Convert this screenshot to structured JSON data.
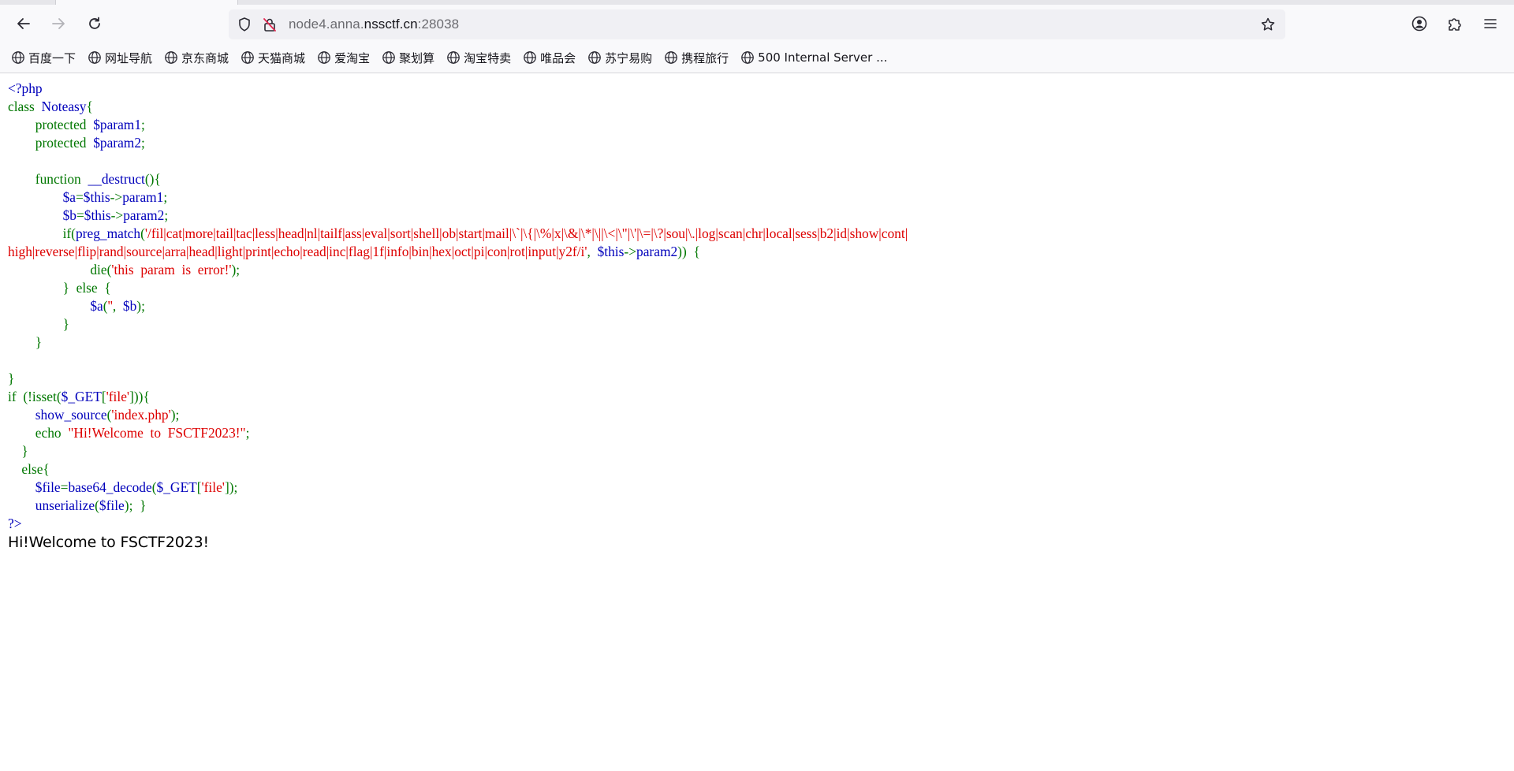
{
  "browser": {
    "url_prefix": "node4.anna.",
    "url_domain": "nssctf.cn",
    "url_port": ":28038",
    "bookmarks": [
      {
        "label": "百度一下",
        "icon": "globe-icon"
      },
      {
        "label": "网址导航",
        "icon": "globe-icon"
      },
      {
        "label": "京东商城",
        "icon": "globe-icon"
      },
      {
        "label": "天猫商城",
        "icon": "globe-icon"
      },
      {
        "label": "爱淘宝",
        "icon": "globe-icon"
      },
      {
        "label": "聚划算",
        "icon": "globe-icon"
      },
      {
        "label": "淘宝特卖",
        "icon": "globe-icon"
      },
      {
        "label": "唯品会",
        "icon": "globe-icon"
      },
      {
        "label": "苏宁易购",
        "icon": "globe-icon"
      },
      {
        "label": "携程旅行",
        "icon": "globe-icon"
      },
      {
        "label": "500 Internal Server ...",
        "icon": "globe-icon"
      }
    ]
  },
  "source_code": [
    [
      [
        "def",
        "<?php"
      ]
    ],
    [
      [
        "kw",
        "class"
      ],
      [
        "def",
        "  Noteasy"
      ],
      [
        "kw",
        "{"
      ]
    ],
    [
      [
        "kw",
        "        protected  "
      ],
      [
        "def",
        "$param1"
      ],
      [
        "kw",
        ";"
      ]
    ],
    [
      [
        "kw",
        "        protected  "
      ],
      [
        "def",
        "$param2"
      ],
      [
        "kw",
        ";"
      ]
    ],
    [
      [
        "def",
        ""
      ]
    ],
    [
      [
        "kw",
        "        function  "
      ],
      [
        "def",
        "__destruct"
      ],
      [
        "kw",
        "(){"
      ]
    ],
    [
      [
        "def",
        "                $a"
      ],
      [
        "kw",
        "="
      ],
      [
        "def",
        "$this"
      ],
      [
        "kw",
        "->"
      ],
      [
        "def",
        "param1"
      ],
      [
        "kw",
        ";"
      ]
    ],
    [
      [
        "def",
        "                $b"
      ],
      [
        "kw",
        "="
      ],
      [
        "def",
        "$this"
      ],
      [
        "kw",
        "->"
      ],
      [
        "def",
        "param2"
      ],
      [
        "kw",
        ";"
      ]
    ],
    [
      [
        "kw",
        "                if("
      ],
      [
        "def",
        "preg_match"
      ],
      [
        "kw",
        "("
      ],
      [
        "str",
        "'/fil|cat|more|tail|tac|less|head|nl|tailf|ass|eval|sort|shell|ob|start|mail|\\`|\\{|\\%|x|\\&|\\*|\\||\\<|\\\"|\\'|\\=|\\?|sou|\\.|log|scan|chr|local|sess|b2|id|show|cont|"
      ]
    ],
    [
      [
        "str",
        "high|reverse|flip|rand|source|arra|head|light|print|echo|read|inc|flag|1f|info|bin|hex|oct|pi|con|rot|input|y2f/i'"
      ],
      [
        "kw",
        ",  "
      ],
      [
        "def",
        "$this"
      ],
      [
        "kw",
        "->"
      ],
      [
        "def",
        "param2"
      ],
      [
        "kw",
        "))  {"
      ]
    ],
    [
      [
        "kw",
        "                        die("
      ],
      [
        "str",
        "'this  param  is  error!'"
      ],
      [
        "kw",
        ");"
      ]
    ],
    [
      [
        "kw",
        "                }  else  {"
      ]
    ],
    [
      [
        "def",
        "                        $a"
      ],
      [
        "kw",
        "("
      ],
      [
        "str",
        "''"
      ],
      [
        "kw",
        ",  "
      ],
      [
        "def",
        "$b"
      ],
      [
        "kw",
        ");"
      ]
    ],
    [
      [
        "kw",
        "                }"
      ]
    ],
    [
      [
        "kw",
        "        }"
      ]
    ],
    [
      [
        "def",
        ""
      ]
    ],
    [
      [
        "kw",
        "}"
      ]
    ],
    [
      [
        "kw",
        "if  (!isset("
      ],
      [
        "def",
        "$_GET"
      ],
      [
        "kw",
        "["
      ],
      [
        "str",
        "'file'"
      ],
      [
        "kw",
        "])){"
      ]
    ],
    [
      [
        "def",
        "        show_source"
      ],
      [
        "kw",
        "("
      ],
      [
        "str",
        "'index.php'"
      ],
      [
        "kw",
        ");"
      ]
    ],
    [
      [
        "kw",
        "        echo  "
      ],
      [
        "str",
        "\"Hi!Welcome  to  FSCTF2023!\""
      ],
      [
        "kw",
        ";"
      ]
    ],
    [
      [
        "kw",
        "    }"
      ]
    ],
    [
      [
        "kw",
        "    else{"
      ]
    ],
    [
      [
        "def",
        "        $file"
      ],
      [
        "kw",
        "="
      ],
      [
        "def",
        "base64_decode"
      ],
      [
        "kw",
        "("
      ],
      [
        "def",
        "$_GET"
      ],
      [
        "kw",
        "["
      ],
      [
        "str",
        "'file'"
      ],
      [
        "kw",
        "]);"
      ]
    ],
    [
      [
        "def",
        "        unserialize"
      ],
      [
        "kw",
        "("
      ],
      [
        "def",
        "$file"
      ],
      [
        "kw",
        ");  }"
      ]
    ],
    [
      [
        "def",
        "?>"
      ]
    ]
  ],
  "echo_output": "Hi!Welcome to FSCTF2023!",
  "colors": {
    "php_default": "#0000bb",
    "php_keyword": "#007700",
    "php_string": "#dd0000"
  }
}
